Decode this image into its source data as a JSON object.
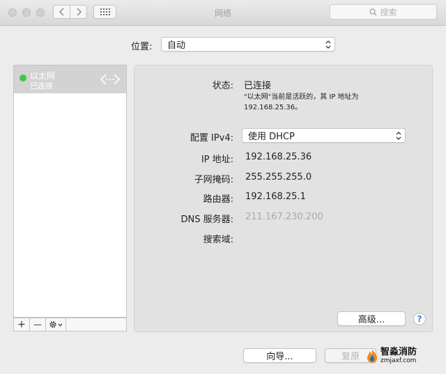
{
  "window": {
    "title": "网络",
    "search_placeholder": "搜索"
  },
  "location": {
    "label": "位置:",
    "value": "自动"
  },
  "sidebar": {
    "items": [
      {
        "name": "以太网",
        "status": "已连接",
        "status_color": "#3fc74a"
      }
    ],
    "add_label": "+",
    "remove_label": "—"
  },
  "detail": {
    "status_label": "状态:",
    "status_value": "已连接",
    "status_note_line1": "\"以太网\"当前是活跃的，其 IP 地址为",
    "status_note_line2": "192.168.25.36。",
    "config_label": "配置 IPv4:",
    "config_value": "使用 DHCP",
    "ip_label": "IP 地址:",
    "ip_value": "192.168.25.36",
    "subnet_label": "子网掩码:",
    "subnet_value": "255.255.255.0",
    "router_label": "路由器:",
    "router_value": "192.168.25.1",
    "dns_label": "DNS 服务器:",
    "dns_value": "211.167.230.200",
    "search_domain_label": "搜索域:",
    "advanced_button": "高级...",
    "help_button": "?"
  },
  "footer": {
    "assist_button": "向导...",
    "revert_button": "复原"
  },
  "watermark": {
    "name": "智淼消防",
    "url": "zmjaxf.com"
  }
}
